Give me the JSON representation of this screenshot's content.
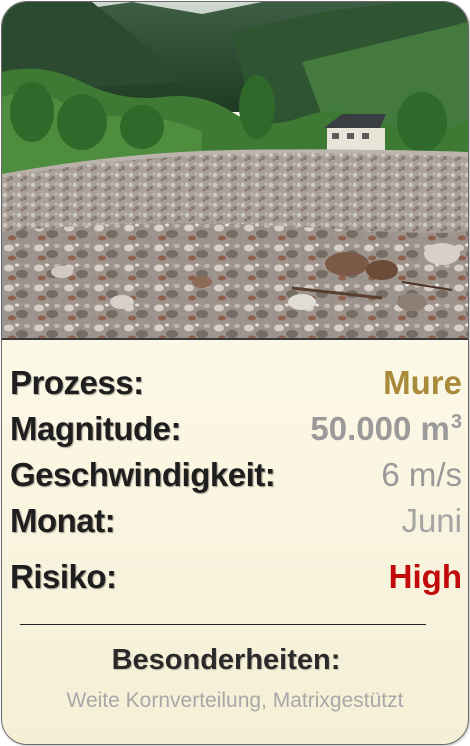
{
  "card": {
    "photo": {
      "subject": "debris-flow-photo"
    },
    "stats": [
      {
        "label": "Prozess:",
        "value": "Mure",
        "color": "#a9893a"
      },
      {
        "label": "Magnitude:",
        "value": "50.000 m",
        "superscript": "3",
        "color": "#9a9a9a"
      },
      {
        "label": "Geschwindigkeit:",
        "value": "6 m/s",
        "color": "#999999"
      },
      {
        "label": "Monat:",
        "value": "Juni",
        "color": "#a4a4a4"
      }
    ],
    "risk": {
      "label": "Risiko:",
      "value": "High",
      "color": "#c20a0a"
    },
    "besonderheiten": {
      "title": "Besonderheiten:",
      "text": "Weite Kornverteilung, Matrixgestützt"
    }
  }
}
